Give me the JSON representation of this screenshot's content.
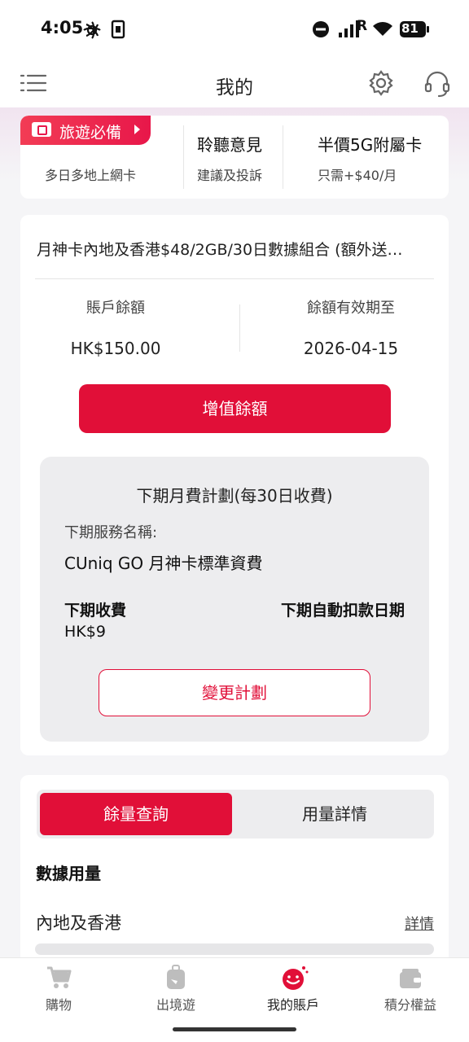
{
  "status_bar": {
    "time": "4:05",
    "battery": "81",
    "signal_badge": "R",
    "icons": [
      "brain-icon",
      "app-icon",
      "dnd-icon",
      "signal-icon",
      "wifi-icon",
      "battery-icon"
    ]
  },
  "header": {
    "title": "我的",
    "left_icon": "menu-icon",
    "right_icons": [
      "settings-icon",
      "headset-icon"
    ]
  },
  "quick_links": [
    {
      "ribbon": "旅遊必備",
      "subtitle": "多日多地上網卡"
    },
    {
      "title": "聆聽意見",
      "subtitle": "建議及投訴"
    },
    {
      "title": "半價5G附屬卡",
      "subtitle": "只需+$40/月"
    }
  ],
  "plan": {
    "name": "月神卡內地及香港$48/2GB/30日數據組合 (額外送…",
    "balance_label": "賬戶餘額",
    "balance_value": "HK$150.00",
    "expiry_label": "餘額有效期至",
    "expiry_value": "2026-04-15",
    "topup_button": "增值餘額",
    "next": {
      "title": "下期月費計劃(每30日收費)",
      "service_label": "下期服務名稱:",
      "service_value": "CUniq GO 月神卡標準資費",
      "fee_label": "下期收費",
      "fee_value": "HK$9",
      "debit_date_label": "下期自動扣款日期",
      "change_button": "變更計劃"
    }
  },
  "usage": {
    "tabs": [
      {
        "label": "餘量查詢",
        "active": true
      },
      {
        "label": "用量詳情",
        "active": false
      }
    ],
    "section_title": "數據用量",
    "region": "內地及香港",
    "detail_link": "詳情"
  },
  "bottom_nav": [
    {
      "label": "購物",
      "icon": "cart-icon",
      "active": false
    },
    {
      "label": "出境遊",
      "icon": "luggage-icon",
      "active": false
    },
    {
      "label": "我的賬戶",
      "icon": "smiley-icon",
      "active": true
    },
    {
      "label": "積分權益",
      "icon": "wallet-icon",
      "active": false
    }
  ],
  "colors": {
    "brand_red": "#e10f38",
    "ribbon_red": "#f23c55",
    "background": "#f5f5f7"
  }
}
